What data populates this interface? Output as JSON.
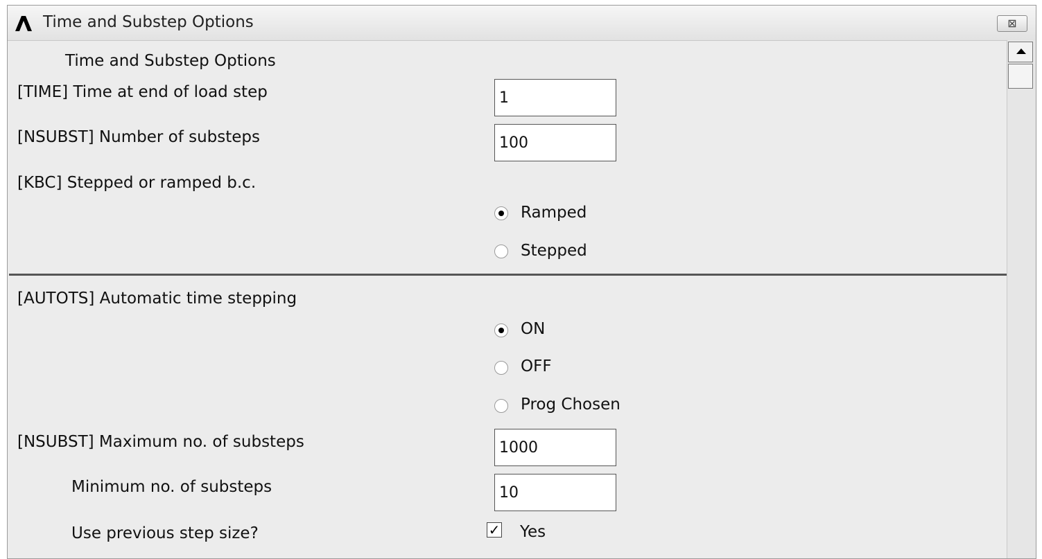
{
  "window": {
    "title": "Time and Substep Options",
    "close_glyph": "⊠"
  },
  "section1": {
    "heading": "Time and Substep Options",
    "time_label": "[TIME]  Time at end of load step",
    "time_value": "1",
    "nsubst_label": "[NSUBST]  Number of substeps",
    "nsubst_value": "100",
    "kbc_label": "[KBC]      Stepped or ramped b.c.",
    "kbc_options": [
      "Ramped",
      "Stepped"
    ],
    "kbc_selected": "Ramped"
  },
  "section2": {
    "autots_label": "[AUTOTS] Automatic time stepping",
    "autots_options": [
      "ON",
      "OFF",
      "Prog Chosen"
    ],
    "autots_selected": "ON",
    "max_label": "[NSUBST] Maximum no. of substeps",
    "max_value": "1000",
    "min_label": "Minimum no. of substeps",
    "min_value": "10",
    "prev_label": "Use previous step size?",
    "prev_checked": true,
    "prev_option": "Yes"
  }
}
